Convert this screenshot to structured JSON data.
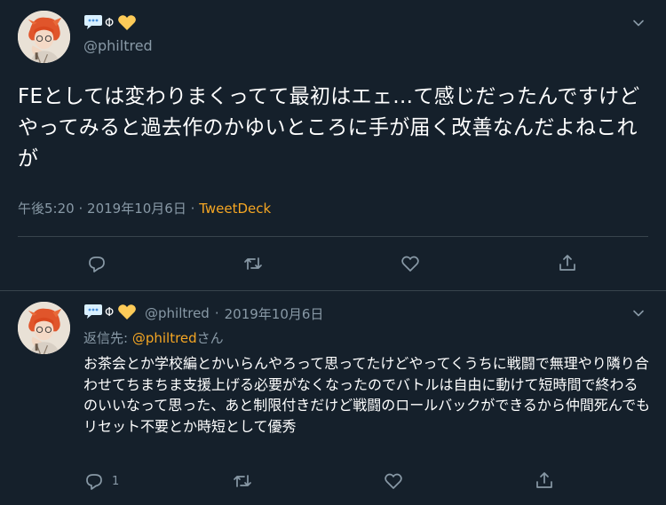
{
  "main_tweet": {
    "handle": "@philtred",
    "text": "FEとしては変わりまくってて最初はエェ…て感じだったんですけどやってみると過去作のかゆいところに手が届く改善なんだよねこれが",
    "time": "午後5:20",
    "date": "2019年10月6日",
    "source": "TweetDeck",
    "dot": "·",
    "name_emojis": [
      "speech-bubble-icon",
      "phi-icon",
      "yellow-heart-icon"
    ]
  },
  "reply_tweet": {
    "handle": "@philtred",
    "date": "2019年10月6日",
    "dot": "·",
    "replying_prefix": "返信先: ",
    "replying_mention": "@philtred",
    "replying_suffix": "さん",
    "text": "お茶会とか学校編とかいらんやろって思ってたけどやってくうちに戦闘で無理やり隣り合わせてちまちま支援上げる必要がなくなったのでバトルは自由に動けて短時間で終わるのいいなって思った、あと制限付きだけど戦闘のロールバックができるから仲間死んでもリセット不要とか時短として優秀",
    "reply_count": "1"
  },
  "colors": {
    "background": "#15202b",
    "secondary_text": "#8899a6",
    "link": "#f5a623",
    "divider": "#38444d"
  }
}
